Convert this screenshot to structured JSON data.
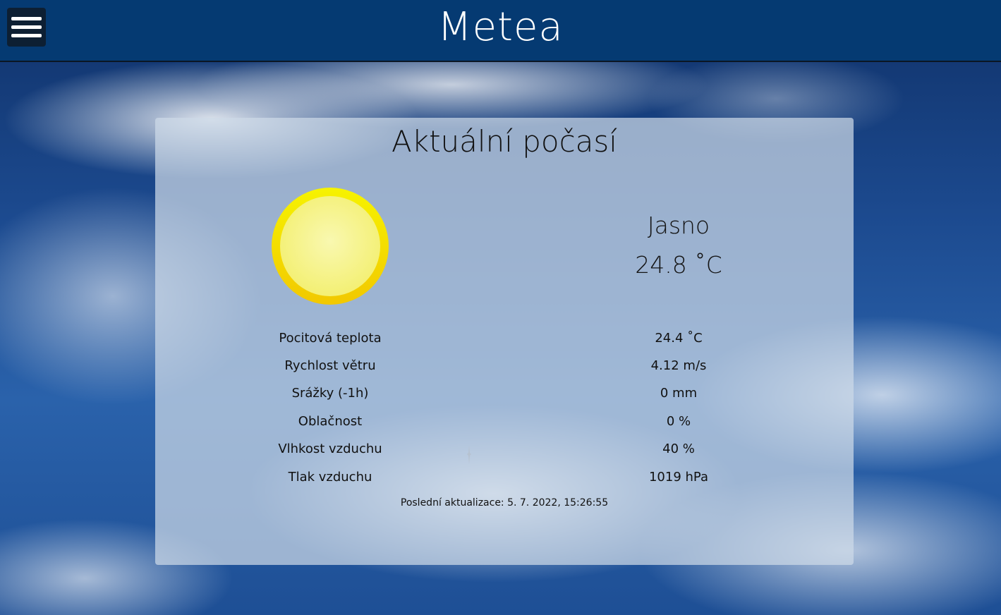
{
  "header": {
    "title": "Metea",
    "menu_icon": "hamburger-menu-icon"
  },
  "weather": {
    "title": "Aktuální počasí",
    "icon": "sun-icon",
    "condition": "Jasno",
    "temperature": "24.8 ˚C",
    "details": [
      {
        "label": "Pocitová teplota",
        "value": "24.4 ˚C"
      },
      {
        "label": "Rychlost větru",
        "value": "4.12 m/s"
      },
      {
        "label": "Srážky (-1h)",
        "value": "0 mm"
      },
      {
        "label": "Oblačnost",
        "value": "0 %"
      },
      {
        "label": "Vlhkost vzduchu",
        "value": "40 %"
      },
      {
        "label": "Tlak vzduchu",
        "value": "1019 hPa"
      }
    ],
    "last_update": "Poslední aktualizace: 5. 7. 2022, 15:26:55"
  },
  "colors": {
    "header_bg": "#053a72",
    "sun_outer": "#f3d600",
    "sun_inner": "#f7f59a"
  }
}
